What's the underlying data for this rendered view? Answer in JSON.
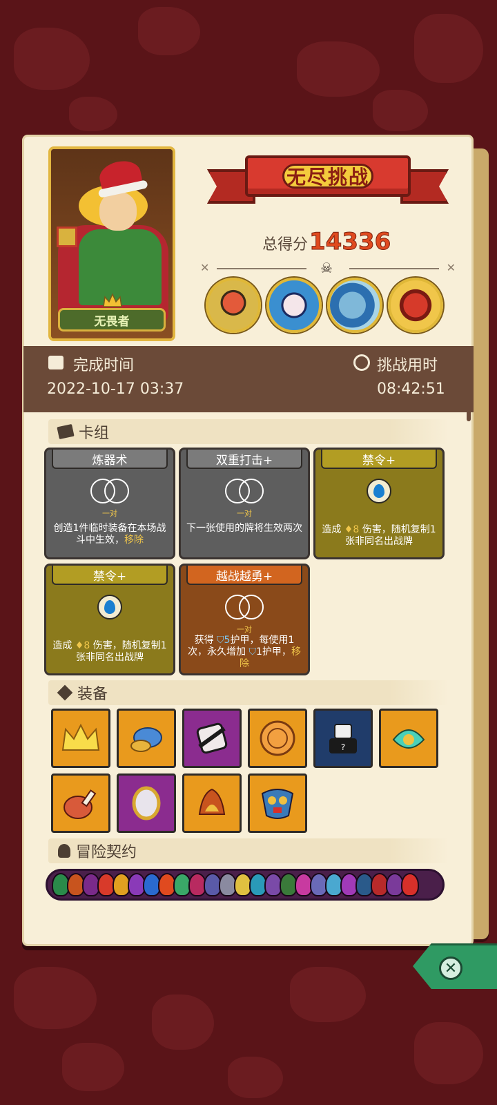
{
  "header": {
    "mode_title": "无尽挑战",
    "score_label": "总得分",
    "score_value": "14336"
  },
  "hero": {
    "name": "无畏者"
  },
  "bosses": [
    {
      "name": "boss-cyclops",
      "color": "#c83a2a"
    },
    {
      "name": "boss-bride",
      "color": "#3a8fd0"
    },
    {
      "name": "boss-shark",
      "color": "#4c8ab8"
    },
    {
      "name": "boss-demon",
      "color": "#b82a20"
    }
  ],
  "info": {
    "complete_label": "完成时间",
    "complete_value": "2022-10-17 03:37",
    "duration_label": "挑战用时",
    "duration_value": "08:42:51"
  },
  "deck": {
    "section_title": "卡组",
    "cards": [
      {
        "title": "炼器术",
        "sub": "一对",
        "desc": "创造1件临时装备在本场战斗中生效，",
        "tag": "移除"
      },
      {
        "title": "双重打击+",
        "sub": "一对",
        "desc": "下一张使用的牌将生效两次",
        "tag": ""
      },
      {
        "title": "禁令+",
        "desc_pre": "造成",
        "dmg": "8",
        "desc": "伤害，随机复制1张非同名出战牌"
      },
      {
        "title": "禁令+",
        "desc_pre": "造成",
        "dmg": "8",
        "desc": "伤害，随机复制1张非同名出战牌"
      },
      {
        "title": "越战越勇+",
        "sub": "一对",
        "desc_pre": "获得",
        "armor": "5",
        "desc_mid": "护甲，每使用1次，永久增加",
        "armor2": "1",
        "desc": "护甲，",
        "tag": "移除"
      }
    ]
  },
  "equipment": {
    "section_title": "装备",
    "items": [
      {
        "name": "crown-icon",
        "color": "orange"
      },
      {
        "name": "blue-gem-icon",
        "color": "orange"
      },
      {
        "name": "broken-dice-icon",
        "color": "purple"
      },
      {
        "name": "gold-coin-icon",
        "color": "orange"
      },
      {
        "name": "magic-hat-icon",
        "color": "navy"
      },
      {
        "name": "dragon-head-icon",
        "color": "orange"
      },
      {
        "name": "ham-icon",
        "color": "orange"
      },
      {
        "name": "mirror-icon",
        "color": "purple"
      },
      {
        "name": "fire-nest-icon",
        "color": "orange"
      },
      {
        "name": "mask-icon",
        "color": "orange"
      }
    ]
  },
  "contracts": {
    "section_title": "冒险契约"
  },
  "colors": {
    "accent_score": "#e04a1f",
    "gold": "#f0c64a",
    "close": "#2f9a63"
  }
}
